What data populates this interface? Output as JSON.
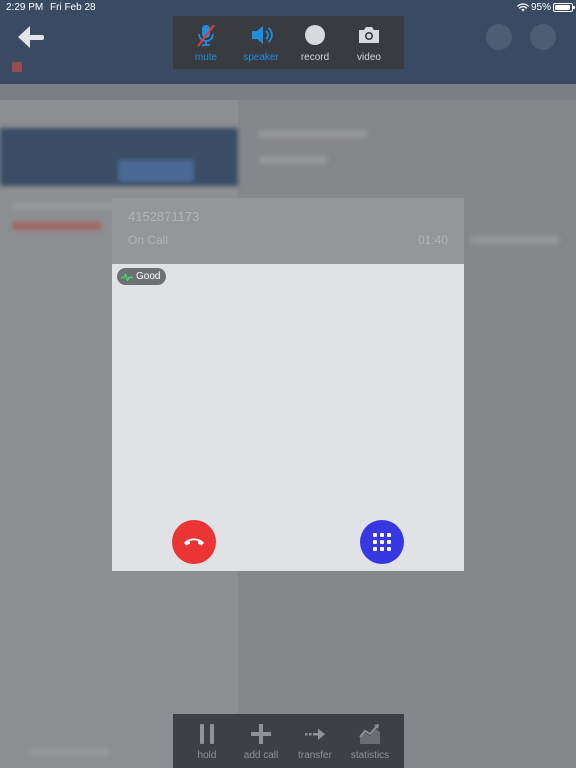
{
  "status_bar": {
    "time": "2:29 PM",
    "date": "Fri Feb 28",
    "battery": "95%"
  },
  "top_controls": [
    {
      "id": "mute",
      "label": "mute",
      "icon": "mic-muted-icon",
      "active": true
    },
    {
      "id": "speaker",
      "label": "speaker",
      "icon": "speaker-icon",
      "active": true
    },
    {
      "id": "record",
      "label": "record",
      "icon": "record-icon",
      "active": false
    },
    {
      "id": "video",
      "label": "video",
      "icon": "camera-icon",
      "active": false
    }
  ],
  "call": {
    "number": "4152871173",
    "status": "On Call",
    "timer": "01:40",
    "quality": "Good",
    "hangup_icon": "hangup-icon",
    "keypad_icon": "keypad-icon"
  },
  "bottom_toolbar": [
    {
      "id": "hold",
      "label": "hold",
      "icon": "pause-icon"
    },
    {
      "id": "add_call",
      "label": "add call",
      "icon": "plus-icon"
    },
    {
      "id": "transfer",
      "label": "transfer",
      "icon": "transfer-arrow-icon"
    },
    {
      "id": "statistics",
      "label": "statistics",
      "icon": "statistics-chart-icon"
    }
  ],
  "colors": {
    "accent_blue": "#1f8de0",
    "hangup_red": "#eb3434",
    "keypad_blue": "#3838e2",
    "quality_green": "#3ddc6a",
    "toolbar_bg": "#383b40",
    "header_bg": "#394a62"
  }
}
